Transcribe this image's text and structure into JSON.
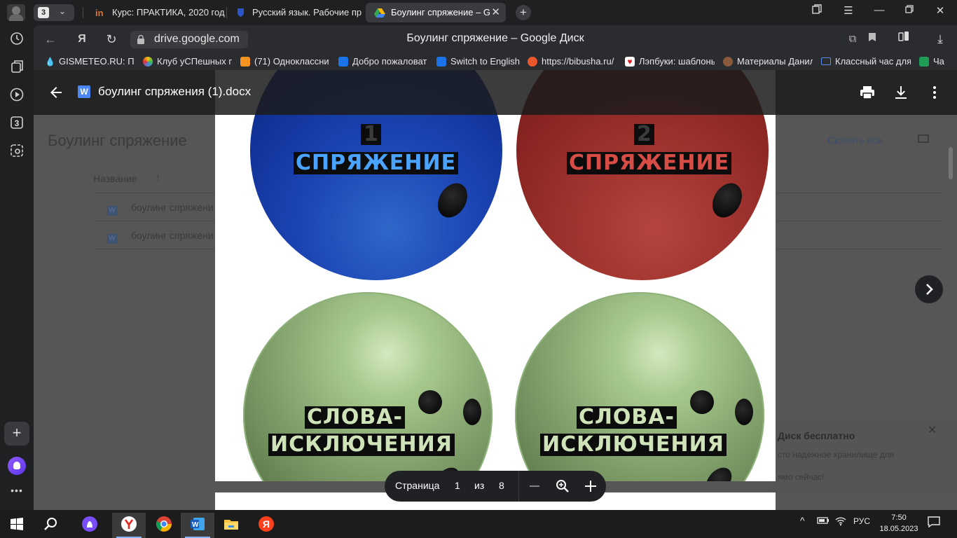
{
  "browser": {
    "tab_count": "3",
    "tabs": [
      {
        "title": "Курс: ПРАКТИКА, 2020 год",
        "icon": "in-logo-icon"
      },
      {
        "title": "Русский язык. Рабочие пр",
        "icon": "shield-logo-icon"
      },
      {
        "title": "Боулинг спряжение – G",
        "icon": "google-drive-icon"
      }
    ],
    "address": "drive.google.com",
    "page_title": "Боулинг спряжение – Google Диск",
    "bookmarks": [
      "GISMETEO.RU: Пог",
      "Клуб уСПешных п",
      "(71) Одноклассни",
      "Добро пожаловат",
      "Switch to English",
      "https://bibusha.ru/",
      "Лэпбуки: шаблоны",
      "Материалы Данил",
      "Классный час для",
      "Ча"
    ],
    "sidebar_badge": "3"
  },
  "drive": {
    "folder_title": "Боулинг спряжение",
    "download_all": "Скачать все",
    "column_name": "Название",
    "files": [
      "боулинг спряжени",
      "боулинг спряжени"
    ],
    "promo_title": "Диск бесплатно",
    "promo_line1": "сто надежное хранилище для",
    "promo_line2": "ямо сейчас!"
  },
  "viewer": {
    "file_name": "боулинг спряжения (1).docx",
    "doc_icon_letter": "W",
    "page_label": "Страница",
    "current_page": "1",
    "of_label": "из",
    "total_pages": "8"
  },
  "document": {
    "balls": [
      {
        "number": "1",
        "label_lines": [
          "СПРЯЖЕНИЕ"
        ],
        "color": "#2a6de0",
        "text_color": "#4aa3ff"
      },
      {
        "number": "2",
        "label_lines": [
          "СПРЯЖЕНИЕ"
        ],
        "color": "#a83a35",
        "text_color": "#d84c46"
      },
      {
        "label_lines": [
          "СЛОВА-",
          "ИСКЛЮЧЕНИЯ"
        ],
        "color": "#8fb27a",
        "text_color": "#cfe3b8"
      },
      {
        "label_lines": [
          "СЛОВА-",
          "ИСКЛЮЧЕНИЯ"
        ],
        "color": "#8fb27a",
        "text_color": "#cfe3b8"
      }
    ]
  },
  "taskbar": {
    "language": "РУС",
    "time": "7:50",
    "date": "18.05.2023"
  },
  "colors": {
    "browser_bg": "#1f2022",
    "toolbar_bg": "#2b2c2f",
    "drive_accent": "#4d86f5"
  }
}
